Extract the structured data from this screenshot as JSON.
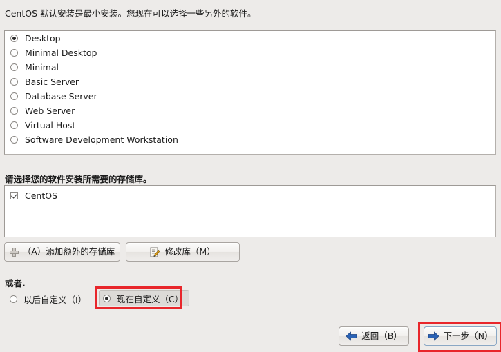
{
  "intro": {
    "text": "CentOS 默认安装是最小安装。您现在可以选择一些另外的软件。"
  },
  "install_groups": {
    "selected": "Desktop",
    "options": [
      {
        "label": "Desktop",
        "selected": true
      },
      {
        "label": "Minimal Desktop",
        "selected": false
      },
      {
        "label": "Minimal",
        "selected": false
      },
      {
        "label": "Basic Server",
        "selected": false
      },
      {
        "label": "Database Server",
        "selected": false
      },
      {
        "label": "Web Server",
        "selected": false
      },
      {
        "label": "Virtual Host",
        "selected": false
      },
      {
        "label": "Software Development Workstation",
        "selected": false
      }
    ]
  },
  "repository": {
    "prompt": "请选择您的软件安装所需要的存储库。",
    "items": [
      {
        "label": "CentOS",
        "checked": true
      }
    ],
    "add_button": "（A）添加额外的存储库",
    "modify_button": "修改库（M）"
  },
  "customize": {
    "or_label": "或者.",
    "later_label": "以后自定义（I）",
    "later_selected": false,
    "now_label": "现在自定义（C）",
    "now_selected": true
  },
  "navigation": {
    "back_label": "返回（B）",
    "next_label": "下一步（N）"
  },
  "colors": {
    "background": "#edebe9",
    "annotation": "#e8262b",
    "arrow_blue": "#2a62b5",
    "pencil_orange": "#e8a317"
  }
}
